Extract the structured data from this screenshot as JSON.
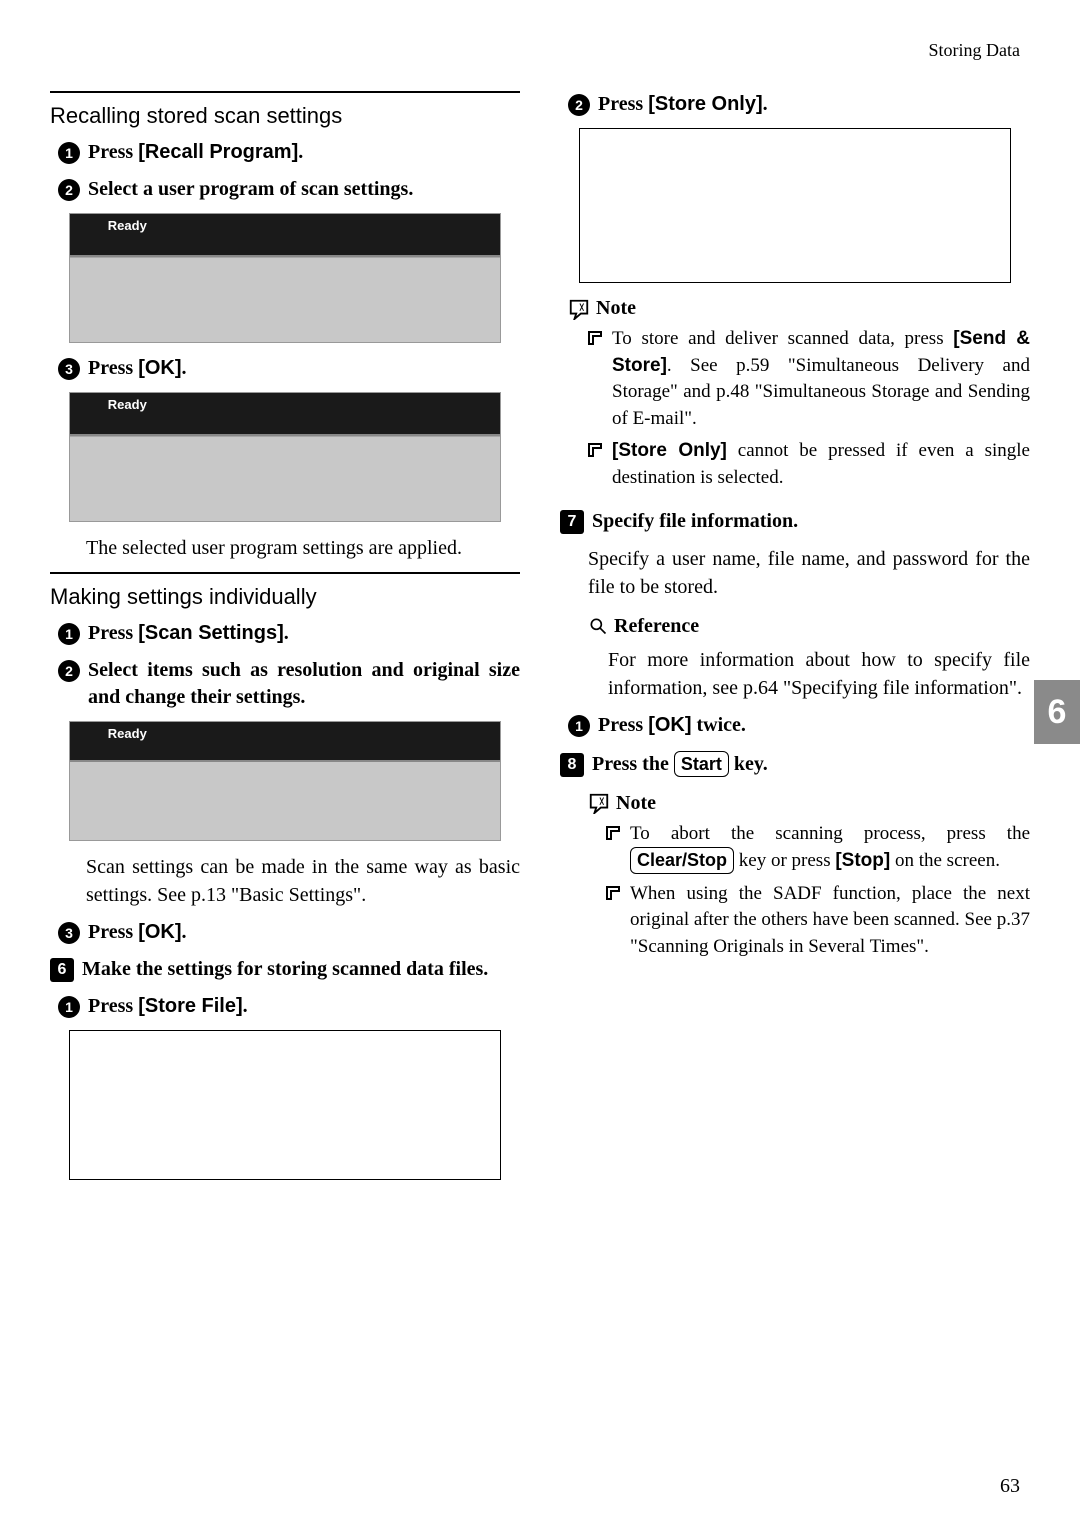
{
  "header": {
    "section": "Storing Data"
  },
  "left": {
    "h_recall": "Recalling stored scan settings",
    "s1": {
      "pre": "Press ",
      "btn": "[Recall Program]",
      "post": "."
    },
    "s2": "Select a user program of scan settings.",
    "shot_ready": "Ready",
    "s3": {
      "pre": "Press ",
      "btn": "[OK]",
      "post": "."
    },
    "s3_body": "The selected user program settings are applied.",
    "h_making": "Making settings individually",
    "m1": {
      "pre": "Press ",
      "btn": "[Scan Settings]",
      "post": "."
    },
    "m2": "Select items such as resolution and original size and change their settings.",
    "m2_body": "Scan settings can be made in the same way as basic settings. See p.13 \"Basic Settings\".",
    "m3": {
      "pre": "Press ",
      "btn": "[OK]",
      "post": "."
    },
    "stepF": "Make the settings for storing scanned data files.",
    "f1": {
      "pre": "Press ",
      "btn": "[Store File]",
      "post": "."
    }
  },
  "right": {
    "r1": {
      "pre": "Press ",
      "btn": "[Store Only]",
      "post": "."
    },
    "note_label": "Note",
    "note1_a": "To store and deliver scanned data, press ",
    "note1_btn": "[Send & Store]",
    "note1_b": ". See p.59 \"Simultaneous Delivery and Storage\" and p.48 \"Simultaneous Storage and Sending of E-mail\".",
    "note2_btn": "[Store Only]",
    "note2_a": " cannot be pressed if even a single destination is selected.",
    "stepG": "Specify file information.",
    "stepG_body": "Specify a user name, file name, and password for the file to be stored.",
    "ref_label": "Reference",
    "ref_body": "For more information about how to specify file information, see p.64 \"Specifying file information\".",
    "g1": {
      "pre": "Press ",
      "btn": "[OK]",
      "post": " twice."
    },
    "stepH_a": "Press the ",
    "stepH_key": "Start",
    "stepH_b": " key.",
    "h_note1_a": "To abort the scanning process, press the ",
    "h_note1_key": "Clear/Stop",
    "h_note1_b": " key or press ",
    "h_note1_btn": "[Stop]",
    "h_note1_c": " on the screen.",
    "h_note2": "When using the SADF function, place the next original after the others have been scanned. See p.37 \"Scanning Originals in Several Times\"."
  },
  "sidetab": "6",
  "page": "63"
}
